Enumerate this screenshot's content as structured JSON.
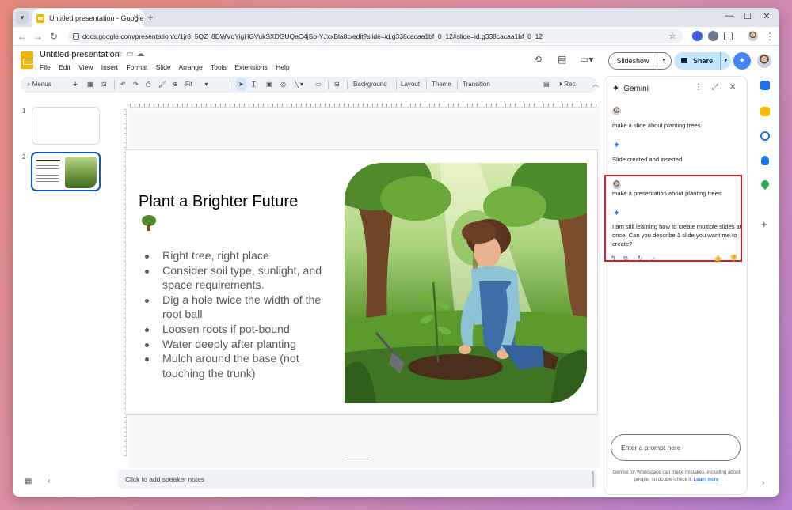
{
  "browser": {
    "tab_title": "Untitled presentation - Google",
    "url": "docs.google.com/presentation/d/1jr8_5QZ_8DWVqYigHGVukSXDGUQaC4jSo-YJxxBla8c/edit?slide=id.g338cacaa1bf_0_12#slide=id.g338cacaa1bf_0_12"
  },
  "doc": {
    "title": "Untitled presentation",
    "menus": [
      "File",
      "Edit",
      "View",
      "Insert",
      "Format",
      "Slide",
      "Arrange",
      "Tools",
      "Extensions",
      "Help"
    ],
    "slideshow_label": "Slideshow",
    "share_label": "Share"
  },
  "toolbar": {
    "menus_label": "Menus",
    "zoom_label": "Fit",
    "background_label": "Background",
    "layout_label": "Layout",
    "theme_label": "Theme",
    "transition_label": "Transition",
    "rec_label": "Rec"
  },
  "filmstrip": {
    "slide_numbers": [
      "1",
      "2"
    ],
    "thumb_title": "Plant a Brighter Future"
  },
  "slide": {
    "title": "Plant a Brighter Future",
    "bullets": [
      "Right tree, right place",
      "Consider soil type, sunlight, and space requirements.",
      "Dig a hole twice the width of the root ball",
      "Loosen roots if pot-bound",
      "Water deeply after planting",
      "Mulch around the base (not touching the trunk)"
    ]
  },
  "notes": {
    "placeholder": "Click to add speaker notes"
  },
  "gemini": {
    "title": "Gemini",
    "messages": [
      {
        "role": "user",
        "text": "make a slide about planting trees"
      },
      {
        "role": "assistant",
        "text": "Slide created and inserted"
      },
      {
        "role": "user",
        "text": "make a presentation about planting trees"
      },
      {
        "role": "assistant",
        "text": "I am still learning how to create multiple slides at once. Can you describe 1 slide you want me to create?"
      }
    ],
    "prompt_placeholder": "Enter a prompt here",
    "disclaimer": "Gemini for Workspace can make mistakes, including about people, so double-check it.",
    "learn_more": "Learn more"
  },
  "colors": {
    "accent_blue": "#0b57d0",
    "share_bg": "#c2e7ff",
    "highlight_red": "#e01b24",
    "slides_yellow": "#f4b400"
  }
}
